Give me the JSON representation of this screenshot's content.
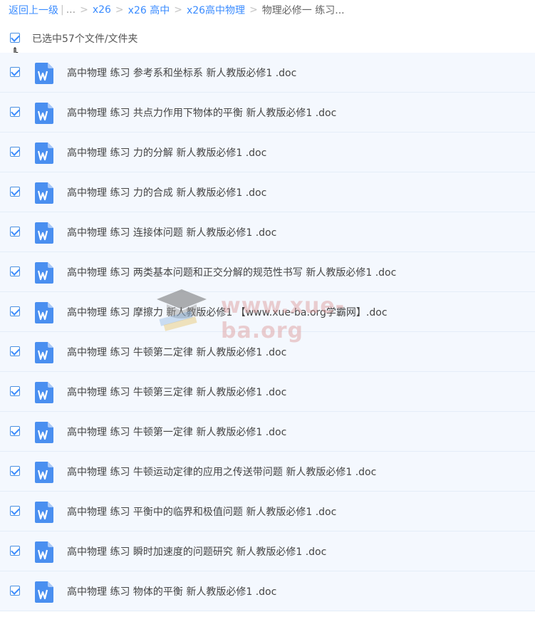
{
  "breadcrumb": {
    "back": "返回上一级",
    "ellipsis": "...",
    "crumbs": [
      "x26",
      "x26 高中",
      "x26高中物理"
    ],
    "current": "物理必修一 练习..."
  },
  "selection": {
    "text": "已选中57个文件/文件夹"
  },
  "files": [
    "高中物理 练习 参考系和坐标系 新人教版必修1 .doc",
    "高中物理 练习 共点力作用下物体的平衡 新人教版必修1 .doc",
    "高中物理 练习 力的分解 新人教版必修1 .doc",
    "高中物理 练习 力的合成 新人教版必修1 .doc",
    "高中物理 练习 连接体问题 新人教版必修1 .doc",
    "高中物理 练习 两类基本问题和正交分解的规范性书写 新人教版必修1 .doc",
    "高中物理 练习 摩擦力 新人教版必修1 【www.xue-ba.org学霸网】.doc",
    "高中物理 练习 牛顿第二定律 新人教版必修1 .doc",
    "高中物理 练习 牛顿第三定律 新人教版必修1 .doc",
    "高中物理 练习 牛顿第一定律 新人教版必修1 .doc",
    "高中物理 练习 牛顿运动定律的应用之传送带问题 新人教版必修1 .doc",
    "高中物理 练习 平衡中的临界和极值问题 新人教版必修1 .doc",
    "高中物理 练习 瞬时加速度的问题研究 新人教版必修1 .doc",
    "高中物理 练习 物体的平衡 新人教版必修1 .doc"
  ],
  "watermark": {
    "text": "www.xue-ba.org"
  },
  "colors": {
    "link": "#3b8cff",
    "row_bg": "#f4f8fe",
    "doc_icon": "#4a8ff0"
  },
  "icons": {
    "file": "word-doc-icon",
    "check": "checkbox-checked-icon",
    "cursor": "hand-pointer-icon"
  }
}
